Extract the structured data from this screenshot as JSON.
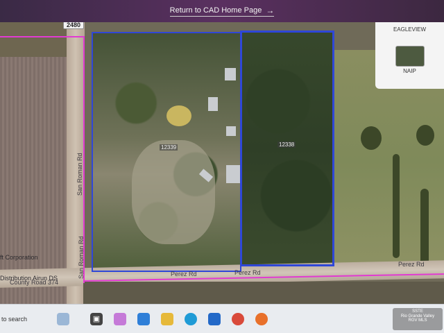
{
  "banner": {
    "link_text": "Return to CAD Home Page",
    "arrow": "→"
  },
  "layers": [
    {
      "label": "EAGLEVIEW",
      "thumb_color": "#6b7a58"
    },
    {
      "label": "NAIP",
      "thumb_color": "#4d5a40"
    }
  ],
  "map": {
    "shield": "2480",
    "roads": [
      "San Roman Rd",
      "San Roman Rd",
      "Perez Rd",
      "Perez Rd",
      "Perez Rd",
      "County Road 374"
    ],
    "labels": [
      "ft Corporation",
      "Distribution Airun DS"
    ],
    "parcels": [
      "12338",
      "12339"
    ]
  },
  "taskbar": {
    "search_text": "to search"
  },
  "watermark": {
    "brand": "SSTE",
    "line1": "Rio Grande Valley",
    "line2": "RGV MLS"
  },
  "colors": {
    "boundary": "#2f47d8",
    "highlight": "#e23ad2"
  }
}
